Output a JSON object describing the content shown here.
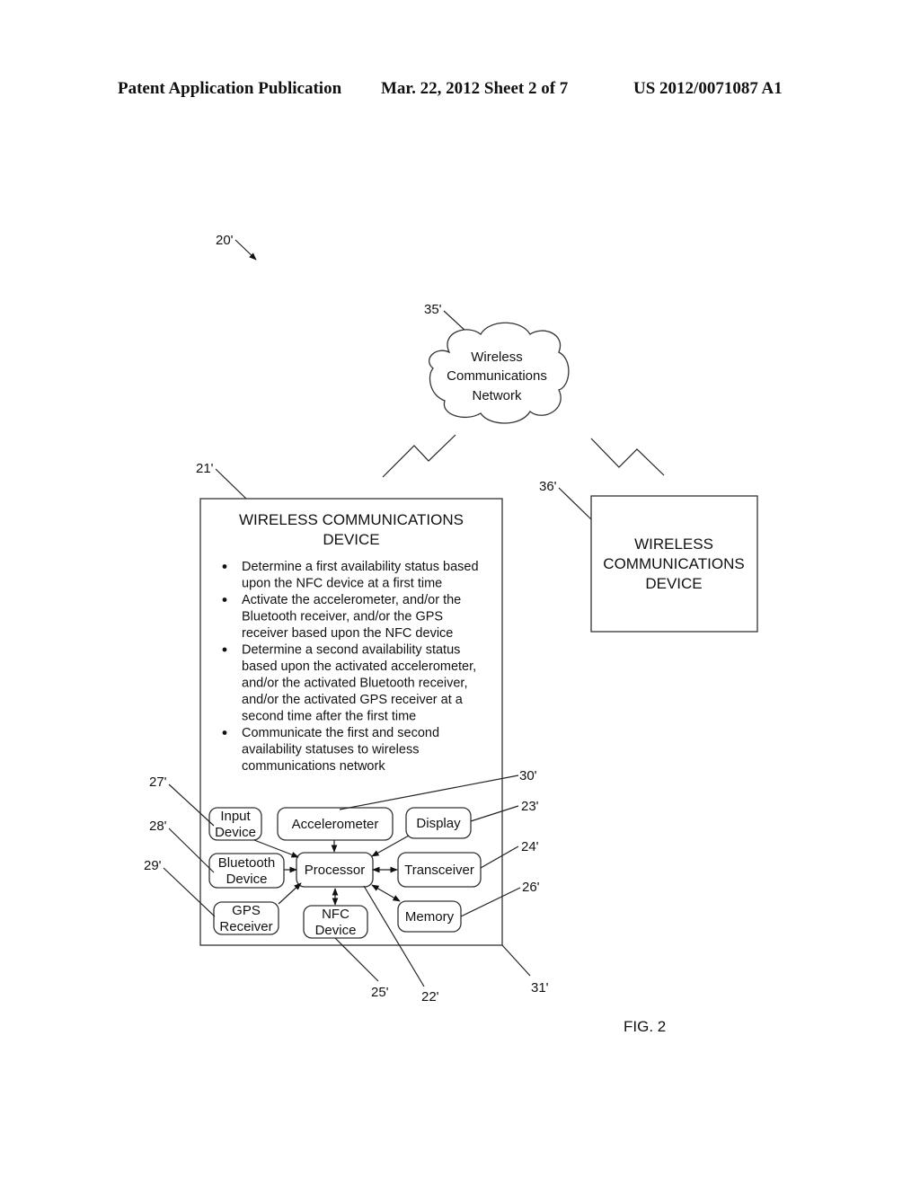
{
  "header": {
    "left": "Patent Application Publication",
    "middle": "Mar. 22, 2012  Sheet 2 of 7",
    "right": "US 2012/0071087 A1"
  },
  "figure": {
    "label": "FIG. 2",
    "system_ref": "20'"
  },
  "network": {
    "ref": "35'",
    "lines": [
      "Wireless",
      "Communications",
      "Network"
    ]
  },
  "device_main": {
    "ref": "21'",
    "housing_ref": "31'",
    "title_lines": [
      "WIRELESS COMMUNICATIONS",
      "DEVICE"
    ],
    "bullets": [
      [
        "Determine a first availability status based",
        "upon the NFC device at a first time"
      ],
      [
        "Activate the accelerometer, and/or the",
        "Bluetooth receiver, and/or the GPS",
        "receiver based upon the NFC device"
      ],
      [
        "Determine a second availability status",
        "based upon the activated accelerometer,",
        "and/or the activated Bluetooth receiver,",
        "and/or the activated GPS receiver at a",
        "second time after the first time"
      ],
      [
        "Communicate the first and second",
        "availability statuses to wireless",
        "communications network"
      ]
    ],
    "components": {
      "input_device": {
        "ref": "27'",
        "lines": [
          "Input",
          "Device"
        ]
      },
      "accelerometer": {
        "ref": "30'",
        "lines": [
          "Accelerometer"
        ]
      },
      "display": {
        "ref": "23'",
        "lines": [
          "Display"
        ]
      },
      "bluetooth": {
        "ref": "28'",
        "lines": [
          "Bluetooth",
          "Device"
        ]
      },
      "processor": {
        "ref": "22'",
        "lines": [
          "Processor"
        ]
      },
      "transceiver": {
        "ref": "24'",
        "lines": [
          "Transceiver"
        ]
      },
      "gps": {
        "ref": "29'",
        "lines": [
          "GPS",
          "Receiver"
        ]
      },
      "nfc": {
        "ref": "25'",
        "lines": [
          "NFC",
          "Device"
        ]
      },
      "memory": {
        "ref": "26'",
        "lines": [
          "Memory"
        ]
      }
    }
  },
  "device_other": {
    "ref": "36'",
    "lines": [
      "WIRELESS",
      "COMMUNICATIONS",
      "DEVICE"
    ]
  }
}
